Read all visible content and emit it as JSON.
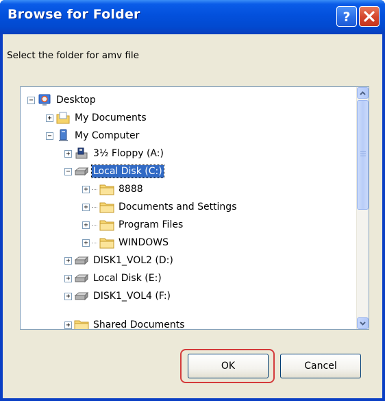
{
  "window": {
    "title": "Browse for Folder",
    "prompt": "Select the folder for amv file"
  },
  "title_buttons": {
    "help": "?",
    "close": "close"
  },
  "tree": {
    "items": [
      {
        "label": "Desktop",
        "icon": "desktop-icon",
        "expander": "−",
        "selected": false
      },
      {
        "label": "My Documents",
        "icon": "folder-documents-icon",
        "expander": "+",
        "selected": false
      },
      {
        "label": "My Computer",
        "icon": "computer-icon",
        "expander": "−",
        "selected": false
      },
      {
        "label": "3½ Floppy (A:)",
        "icon": "floppy-drive-icon",
        "expander": "+",
        "selected": false
      },
      {
        "label": "Local Disk (C:)",
        "icon": "hard-disk-icon",
        "expander": "−",
        "selected": true
      },
      {
        "label": "8888",
        "icon": "folder-icon",
        "expander": "+",
        "selected": false
      },
      {
        "label": "Documents and Settings",
        "icon": "folder-icon",
        "expander": "+",
        "selected": false
      },
      {
        "label": "Program Files",
        "icon": "folder-icon",
        "expander": "+",
        "selected": false
      },
      {
        "label": "WINDOWS",
        "icon": "folder-icon",
        "expander": "+",
        "selected": false
      },
      {
        "label": "DISK1_VOL2 (D:)",
        "icon": "hard-disk-icon",
        "expander": "+",
        "selected": false
      },
      {
        "label": "Local Disk (E:)",
        "icon": "hard-disk-icon",
        "expander": "+",
        "selected": false
      },
      {
        "label": "DISK1_VOL4 (F:)",
        "icon": "hard-disk-icon",
        "expander": "+",
        "selected": false
      },
      {
        "label": "Shared Documents",
        "icon": "folder-icon",
        "expander": "+",
        "selected": false
      }
    ]
  },
  "buttons": {
    "ok": "OK",
    "cancel": "Cancel"
  },
  "colors": {
    "titlebar": "#0350dc",
    "selection": "#316ac5",
    "highlight_ring": "#d43a3a"
  }
}
